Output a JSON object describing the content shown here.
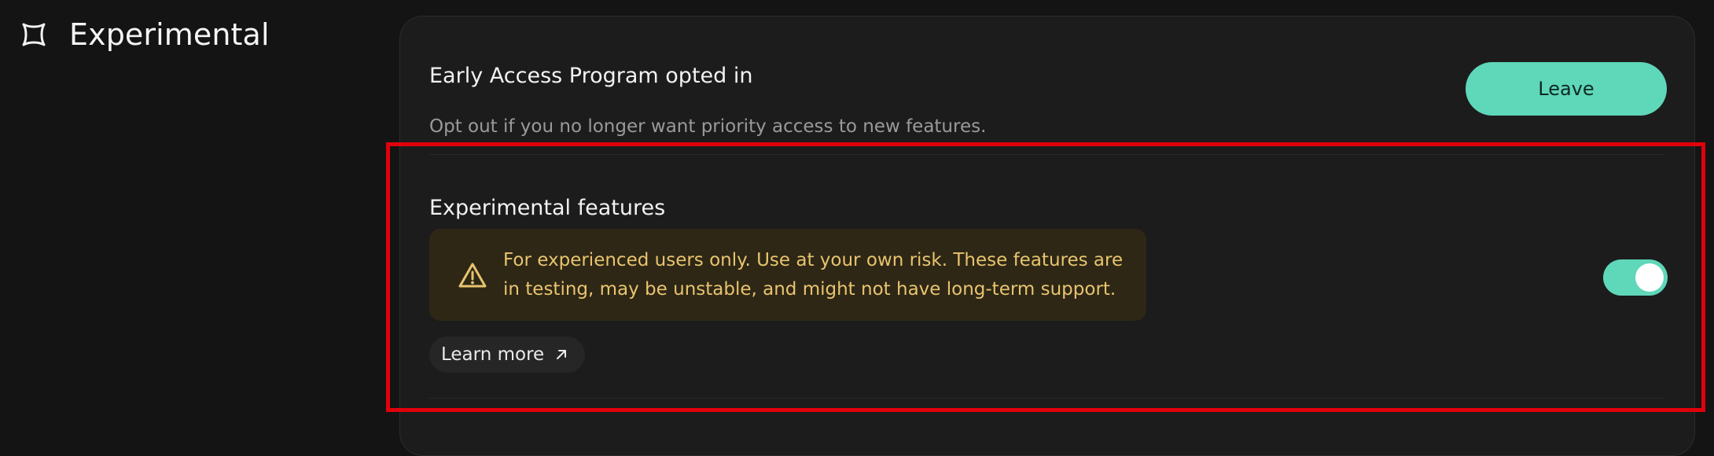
{
  "page": {
    "title": "Experimental",
    "icon": "sparkle-icon"
  },
  "early_access": {
    "title": "Early Access Program opted in",
    "description": "Opt out if you no longer want priority access to new features.",
    "leave_label": "Leave"
  },
  "experimental_features": {
    "title": "Experimental features",
    "warning_icon": "warning-triangle-icon",
    "warning_text": "For experienced users only. Use at your own risk. These features are in testing, may be unstable, and might not have long-term support.",
    "learn_more_label": "Learn more",
    "learn_more_icon": "external-arrow-icon",
    "toggle_on": true
  },
  "colors": {
    "accent": "#5fd7b9",
    "warning_text": "#e8c46e",
    "warning_bg": "#2e2716",
    "highlight": "#e0000b",
    "background": "#141414",
    "card": "#1c1c1c"
  }
}
